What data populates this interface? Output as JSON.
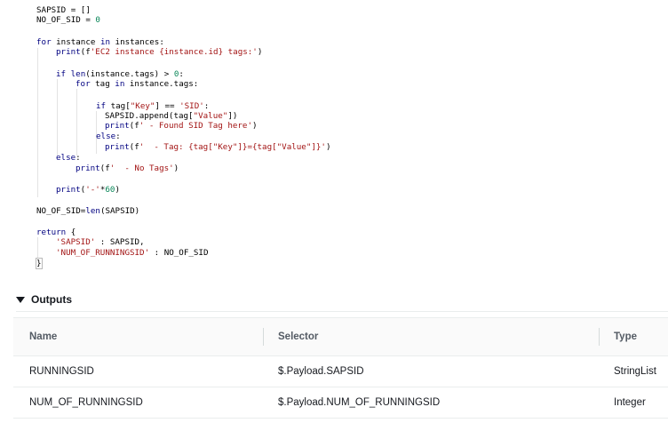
{
  "code": {
    "lines": [
      "SAPSID = []",
      "NO_OF_SID = 0",
      "for instance in instances:",
      "print(f'EC2 instance {instance.id} tags:')",
      "if len(instance.tags) > 0:",
      "for tag in instance.tags:",
      "if tag[\"Key\"] == 'SID':",
      "SAPSID.append(tag[\"Value\"])",
      "print(f' - Found SID Tag here')",
      "else:",
      "print(f'  - Tag: {tag[\"Key\"]}={tag[\"Value\"]}')",
      "else:",
      "print(f'  - No Tags')",
      "print('-'*60)",
      "NO_OF_SID=len(SAPSID)",
      "return {",
      "'SAPSID' : SAPSID,",
      "'NUM_OF_RUNNINGSID' : NO_OF_SID",
      "}"
    ]
  },
  "outputs": {
    "title": "Outputs",
    "columns": [
      "Name",
      "Selector",
      "Type"
    ],
    "rows": [
      [
        "RUNNINGSID",
        "$.Payload.SAPSID",
        "StringList"
      ],
      [
        "NUM_OF_RUNNINGSID",
        "$.Payload.NUM_OF_RUNNINGSID",
        "Integer"
      ]
    ]
  },
  "colors": {
    "keyword": "#000080",
    "string": "#a31515",
    "number": "#098658",
    "header_bg": "#fafafa",
    "border": "#eaeded",
    "text": "#16191f",
    "header_text": "#545b64"
  },
  "icons": {
    "outputs_toggle": "caret-down-icon"
  }
}
